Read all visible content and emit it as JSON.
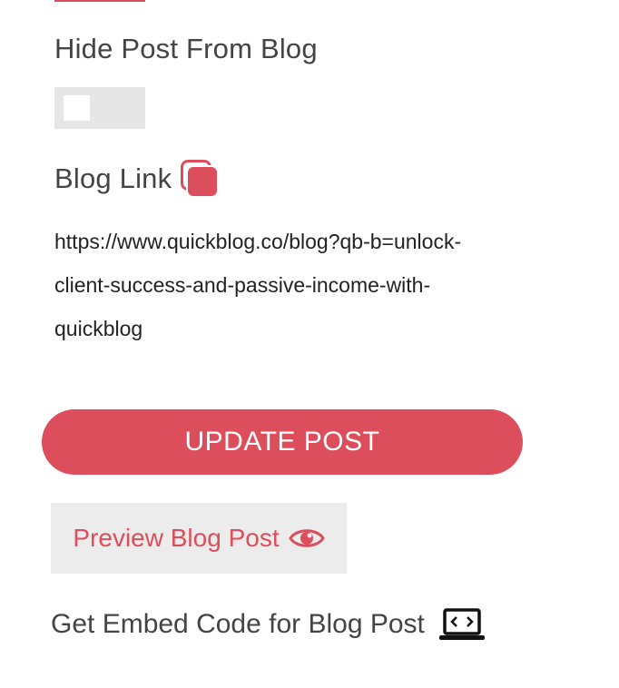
{
  "hide_post": {
    "heading": "Hide Post From Blog",
    "toggle_state": "off"
  },
  "blog_link": {
    "heading": "Blog Link",
    "copy_icon": "copy-icon",
    "url": "https://www.quickblog.co/blog?qb-b=unlock-client-success-and-passive-income-with-quickblog"
  },
  "actions": {
    "update_label": "UPDATE POST",
    "preview_label": "Preview Blog Post",
    "preview_icon": "eye-icon",
    "embed_label": "Get Embed Code for Blog Post",
    "embed_icon": "laptop-code-icon"
  },
  "colors": {
    "accent": "#dc4e5c",
    "toggle_track": "#e6e6e6",
    "preview_bg": "#ececec"
  }
}
